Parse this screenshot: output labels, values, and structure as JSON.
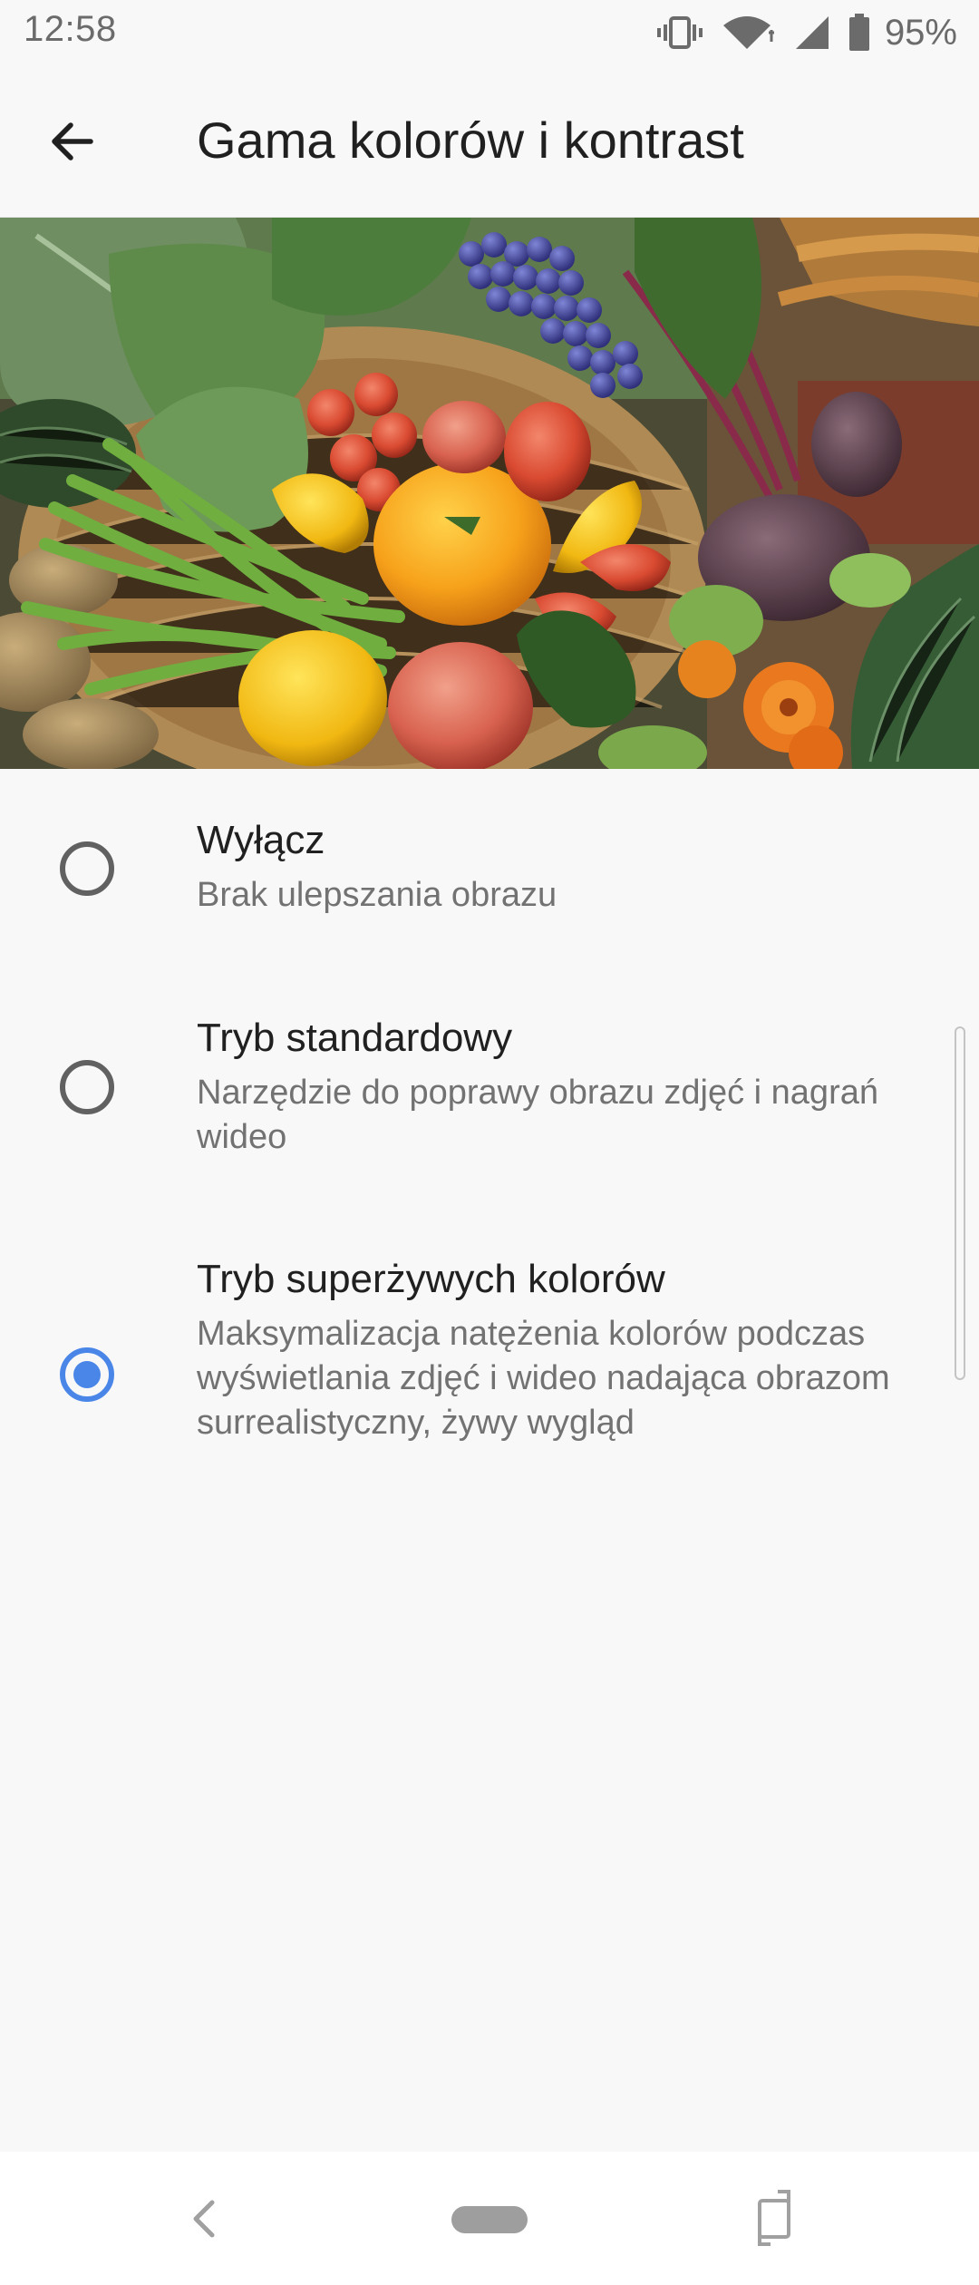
{
  "status_bar": {
    "time": "12:58",
    "battery_percent": "95%",
    "icons": [
      "vibrate-icon",
      "wifi-icon",
      "signal-icon",
      "battery-icon"
    ]
  },
  "app_bar": {
    "back_icon": "arrow-back-icon",
    "title": "Gama kolorów i kontrast"
  },
  "preview": {
    "description_icon": "vegetables-photo"
  },
  "options": [
    {
      "title": "Wyłącz",
      "summary": "Brak ulepszania obrazu",
      "selected": false
    },
    {
      "title": "Tryb standardowy",
      "summary": "Narzędzie do poprawy obrazu zdjęć i nagrań wideo",
      "selected": false
    },
    {
      "title": "Tryb superżywych kolorów",
      "summary": "Maksymalizacja natężenia kolorów podczas wyświetlania zdjęć i wideo nadająca obrazom surrealistyczny, żywy wygląd",
      "selected": true
    }
  ],
  "nav_bar": {
    "icons": [
      "nav-back-icon",
      "nav-home-pill",
      "rotate-icon"
    ]
  },
  "colors": {
    "accent": "#4a86e8",
    "background": "#f8f8f8",
    "title_text": "#202020",
    "summary_text": "#727272"
  }
}
